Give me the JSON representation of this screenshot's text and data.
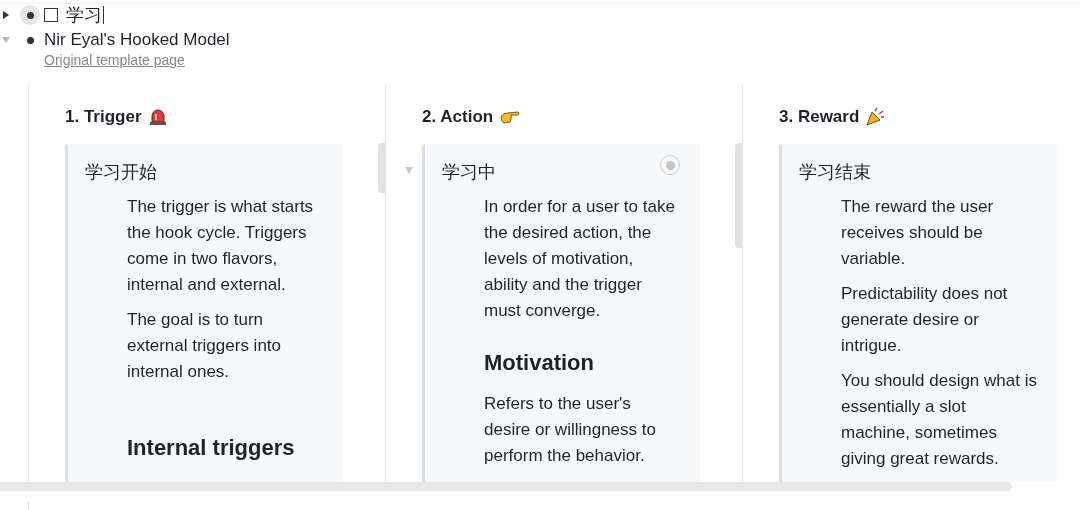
{
  "outline": [
    {
      "kind": "task",
      "text": "学习",
      "expanded": false,
      "checked": false,
      "focused": true
    },
    {
      "kind": "note",
      "text": "Nir Eyal's Hooked Model",
      "expanded": true,
      "focused": false,
      "link": "Original template page"
    }
  ],
  "columns": [
    {
      "title": "1. Trigger",
      "card": {
        "title": "学习开始",
        "blocks": [
          {
            "kind": "paragraph",
            "text": "The trigger is what starts the hook cycle. Triggers come in two flavors, internal and external."
          },
          {
            "kind": "paragraph",
            "text": "The goal is to turn external triggers into internal ones."
          },
          {
            "kind": "heading",
            "text": "Internal triggers"
          }
        ]
      }
    },
    {
      "title": "2. Action",
      "card": {
        "title": "学习中",
        "blocks": [
          {
            "kind": "paragraph",
            "text": "In order for a user to take the desired action, the levels of motivation, ability and the trigger must converge."
          },
          {
            "kind": "heading",
            "text": "Motivation"
          },
          {
            "kind": "paragraph",
            "text": "Refers to the user's desire or willingness to perform the behavior."
          }
        ]
      }
    },
    {
      "title": "3. Reward",
      "card": {
        "title": "学习结束",
        "blocks": [
          {
            "kind": "paragraph",
            "text": "The reward the user receives should be variable."
          },
          {
            "kind": "paragraph",
            "text": "Predictability does not generate desire or intrigue."
          },
          {
            "kind": "paragraph",
            "text": "You should design what is essentially a slot machine, sometimes giving great rewards."
          }
        ]
      }
    }
  ]
}
